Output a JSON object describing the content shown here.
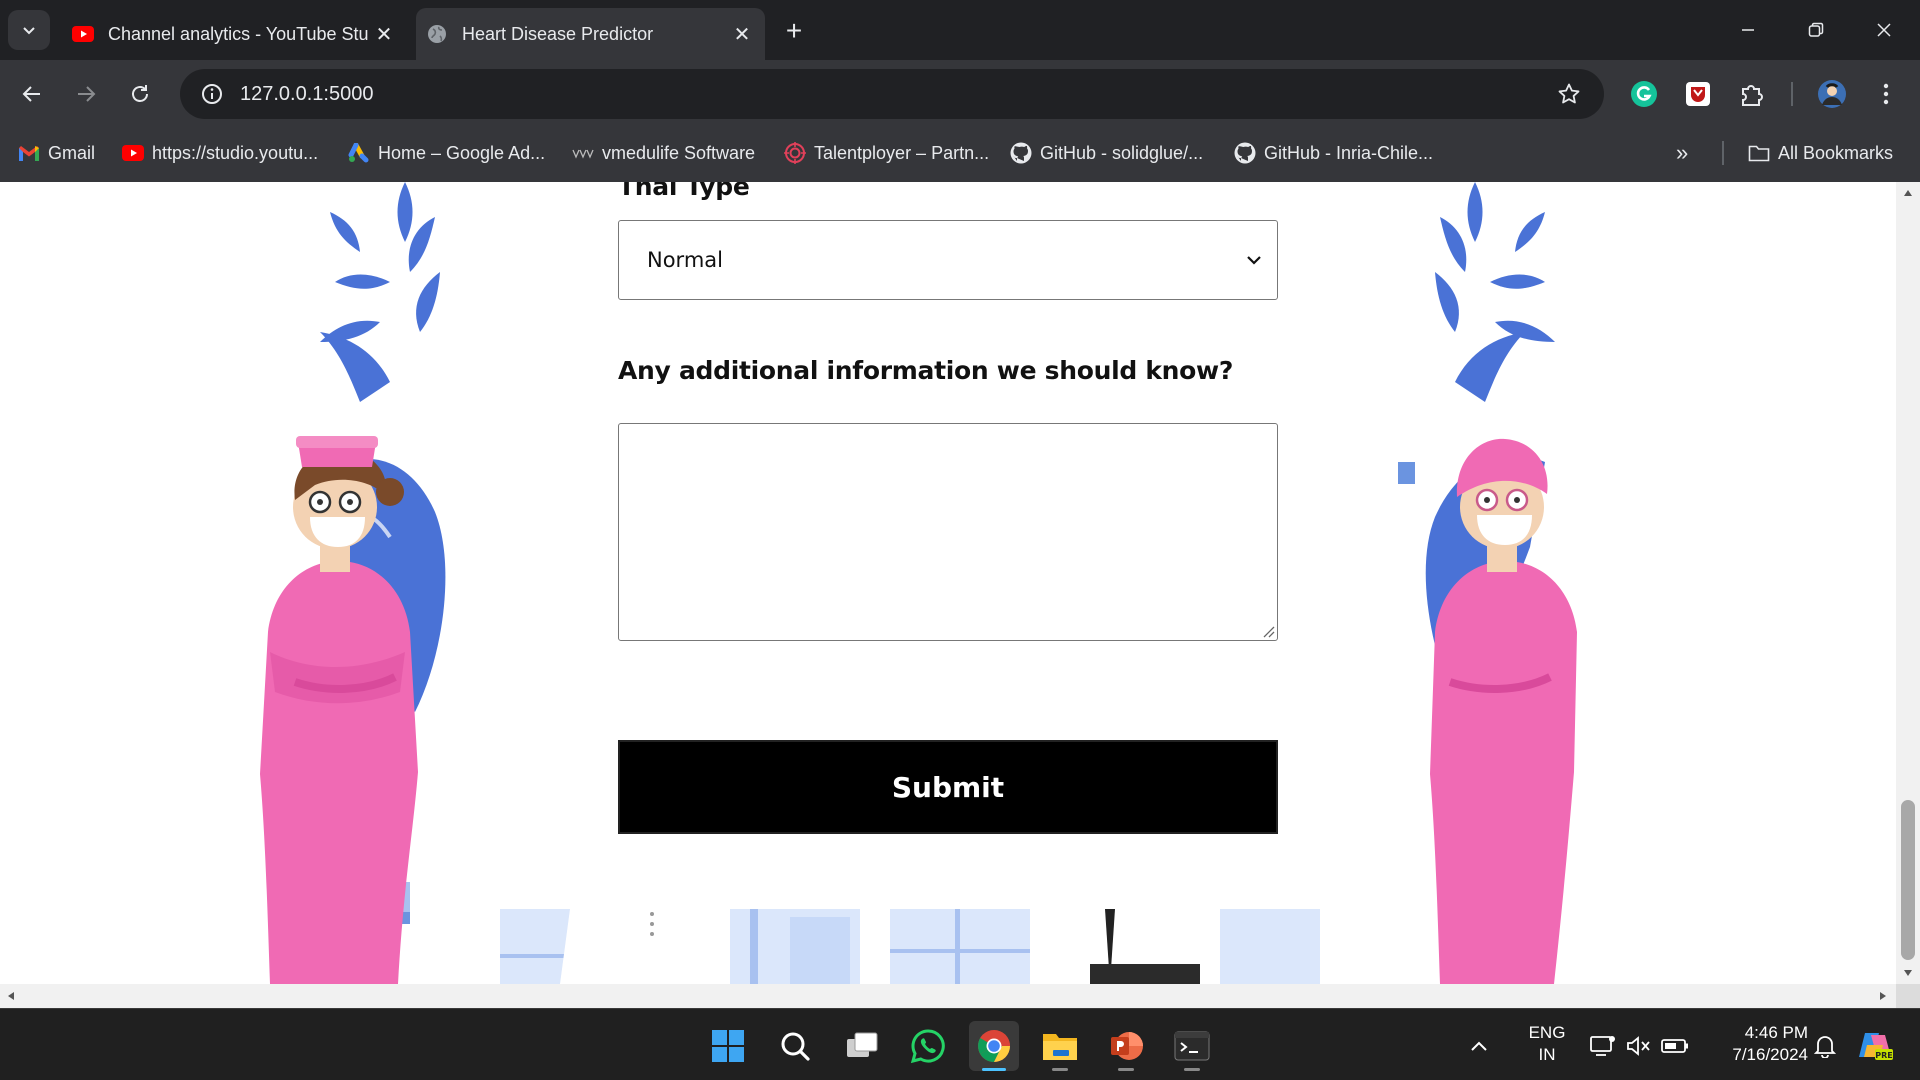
{
  "browser": {
    "tabs": [
      {
        "title": "Channel analytics - YouTube Stu",
        "icon": "youtube-icon"
      },
      {
        "title": "Heart Disease Predictor",
        "icon": "globe-icon",
        "active": true
      }
    ],
    "url": "127.0.0.1:5000",
    "bookmarks": [
      {
        "label": "Gmail",
        "icon": "gmail-icon"
      },
      {
        "label": "https://studio.youtu...",
        "icon": "youtube-icon"
      },
      {
        "label": "Home – Google Ad...",
        "icon": "google-ads-icon"
      },
      {
        "label": "vmedulife Software",
        "icon": "vmedulife-icon"
      },
      {
        "label": "Talentployer – Partn...",
        "icon": "target-icon"
      },
      {
        "label": "GitHub - solidglue/...",
        "icon": "github-icon"
      },
      {
        "label": "GitHub - Inria-Chile...",
        "icon": "github-icon"
      }
    ],
    "all_bookmarks_label": "All Bookmarks"
  },
  "form": {
    "thal_label": "Thal Type",
    "thal_value": "Normal",
    "additional_label": "Any additional information we should know?",
    "additional_value": "",
    "submit_label": "Submit"
  },
  "taskbar": {
    "language": "ENG",
    "region": "IN",
    "time": "4:46 PM",
    "date": "7/16/2024"
  },
  "colors": {
    "accent": "#4cc2ff",
    "illustration_pink": "#f06ab4",
    "illustration_blue": "#4a72d6",
    "chrome_dark": "#202124",
    "chrome_mid": "#35363a"
  }
}
